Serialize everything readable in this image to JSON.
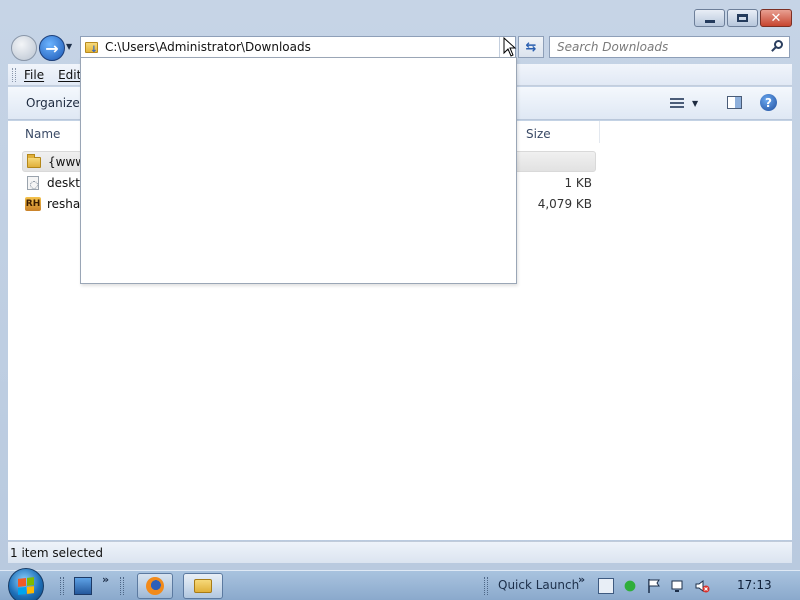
{
  "window": {
    "caption_buttons": {
      "minimize_icon": "minimize-icon",
      "maximize_icon": "maximize-icon",
      "close_icon": "close-icon",
      "close_glyph": "✕"
    }
  },
  "nav": {
    "back_icon": "back-arrow-icon",
    "forward_icon": "forward-arrow-icon",
    "forward_glyph": "→",
    "recent_glyph": "▼",
    "address": "C:\\Users\\Administrator\\Downloads",
    "address_dropdown_glyph": "▼",
    "refresh_glyph": "⇆",
    "search_placeholder": "Search Downloads"
  },
  "menu": {
    "items": [
      "File",
      "Edit"
    ]
  },
  "commandbar": {
    "organize_label": "Organize",
    "help_glyph": "?"
  },
  "columns": {
    "name": "Name",
    "size": "Size"
  },
  "files": [
    {
      "name": "{www.",
      "size": "",
      "icon": "folder-icon",
      "selected": true
    },
    {
      "name": "deskto",
      "size": "1 KB",
      "icon": "settings-file-icon",
      "selected": false
    },
    {
      "name": "reshac",
      "size": "4,079 KB",
      "icon": "resource-hacker-icon",
      "selected": false
    }
  ],
  "rh_icon_text": "RH",
  "status": {
    "text": "1 item selected"
  },
  "taskbar": {
    "chevron": "»",
    "quick_launch_label": "Quick Launch",
    "clock": "17:13"
  },
  "colors": {
    "frame": "#b9cadf",
    "accent": "#1c58b5",
    "selection": "#e2e2e2"
  }
}
